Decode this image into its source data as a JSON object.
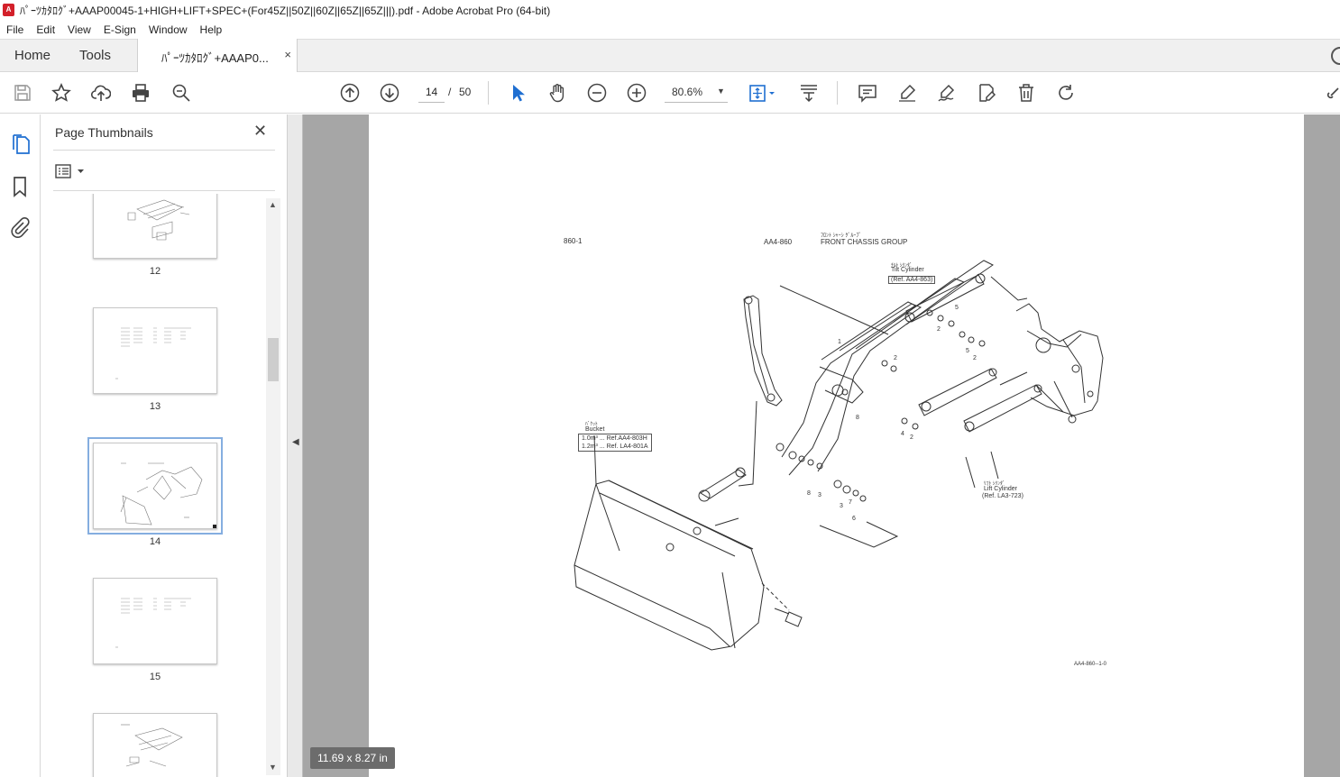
{
  "window": {
    "title": "ﾊﾟｰﾂｶﾀﾛｸﾞ+AAAP00045-1+HIGH+LIFT+SPEC+(For45Z||50Z||60Z||65Z||65Z|||).pdf - Adobe Acrobat Pro (64-bit)",
    "icon": "acrobat-icon"
  },
  "menu": [
    "File",
    "Edit",
    "View",
    "E-Sign",
    "Window",
    "Help"
  ],
  "tabs": {
    "home": "Home",
    "tools": "Tools",
    "document": "ﾊﾟｰﾂｶﾀﾛｸﾞ+AAAP0...",
    "close": "×"
  },
  "toolbar": {
    "page_current": "14",
    "page_separator": "/",
    "page_total": "50",
    "zoom": "80.6%",
    "icons": [
      "save-icon",
      "star-icon",
      "upload-icon",
      "print-icon",
      "zoom-search-icon",
      "page-up-icon",
      "page-down-icon",
      "select-cursor-icon",
      "hand-icon",
      "zoom-out-icon",
      "zoom-in-icon",
      "fit-page-icon",
      "scroll-mode-icon",
      "comment-icon",
      "highlight-icon",
      "sign-icon",
      "edit-pdf-icon",
      "delete-icon",
      "rotate-icon",
      "share-link-icon"
    ]
  },
  "leftrail": {
    "icons": [
      "page-thumbnails-icon",
      "bookmark-icon",
      "attachment-icon"
    ]
  },
  "thumbnails": {
    "title": "Page Thumbnails",
    "close": "✕",
    "pages": [
      {
        "num": "12",
        "selected": false
      },
      {
        "num": "13",
        "selected": false
      },
      {
        "num": "14",
        "selected": true
      },
      {
        "num": "15",
        "selected": false
      },
      {
        "num": "",
        "selected": false
      }
    ]
  },
  "document": {
    "page_size": "11.69 x 8.27 in",
    "drawing": {
      "page_code": "860-1",
      "group_code": "AA4-860",
      "group_jp": "ﾌﾛﾝﾄ ｼｬｰｼ ｸﾞﾙｰﾌﾟ",
      "group_en": "FRONT CHASSIS GROUP",
      "tilt_jp": "ﾁﾙﾄ ｼﾘﾝﾀﾞ",
      "tilt_en": "Tilt Cylinder",
      "tilt_ref": "(Ref. AA4-863)",
      "bucket_jp": "ﾊﾞｹｯﾄ",
      "bucket_en": "Bucket",
      "bucket_ref1": "1.0m³ ... Ref.AA4-803H",
      "bucket_ref2": "1.2m³ ... Ref. LA4-801A",
      "lift_jp": "ﾘﾌﾄ ｼﾘﾝﾀﾞ",
      "lift_en": "Lift Cylinder",
      "lift_ref": "(Ref. LA3-723)",
      "footer_code": "AA4-860--1-0",
      "callouts": [
        "1",
        "2",
        "5",
        "2",
        "5",
        "2",
        "2",
        "3",
        "8",
        "4",
        "2",
        "8",
        "3",
        "3",
        "7",
        "6"
      ]
    }
  }
}
